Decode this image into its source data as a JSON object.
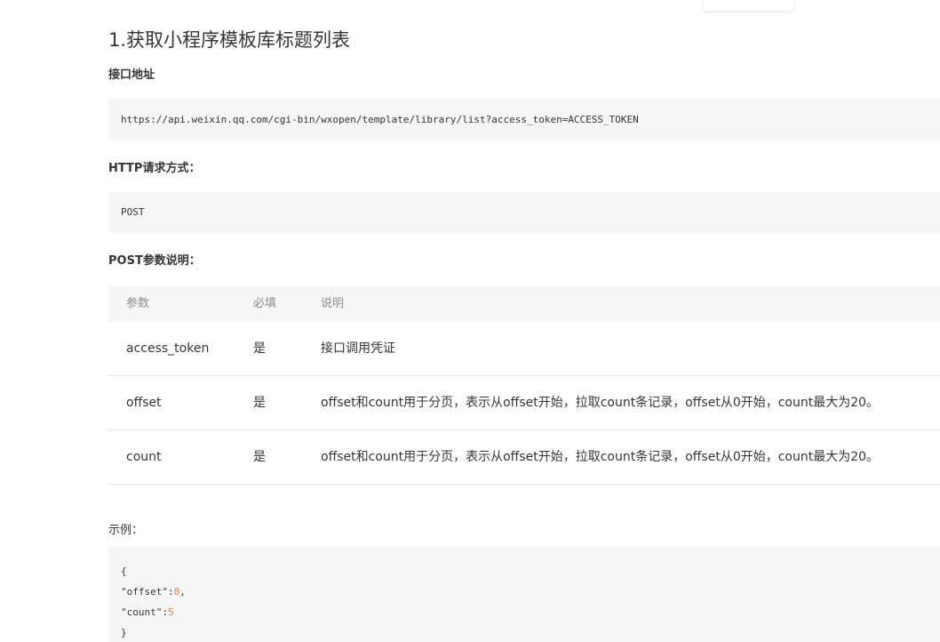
{
  "section": {
    "title": "1.获取小程序模板库标题列表",
    "endpoint_heading": "接口地址",
    "endpoint_url": "https://api.weixin.qq.com/cgi-bin/wxopen/template/library/list?access_token=ACCESS_TOKEN",
    "method_heading": "HTTP请求方式：",
    "method": "POST",
    "params_heading": "POST参数说明："
  },
  "table": {
    "headers": [
      "参数",
      "必填",
      "说明"
    ],
    "rows": [
      {
        "name": "access_token",
        "required": "是",
        "desc": "接口调用凭证"
      },
      {
        "name": "offset",
        "required": "是",
        "desc": "offset和count用于分页，表示从offset开始，拉取count条记录，offset从0开始，count最大为20。"
      },
      {
        "name": "count",
        "required": "是",
        "desc": "offset和count用于分页，表示从offset开始，拉取count条记录，offset从0开始，count最大为20。"
      }
    ]
  },
  "example": {
    "label": "示例：",
    "lines": {
      "open": "{",
      "offset_key": "\"offset\":",
      "offset_val": "0",
      "offset_comma": ",",
      "count_key": "\"count\":",
      "count_val": "5",
      "close": "}"
    }
  },
  "colors": {
    "code_bg": "#f6f6f6",
    "number": "#e6813f",
    "header_text": "#8d8d8d"
  }
}
